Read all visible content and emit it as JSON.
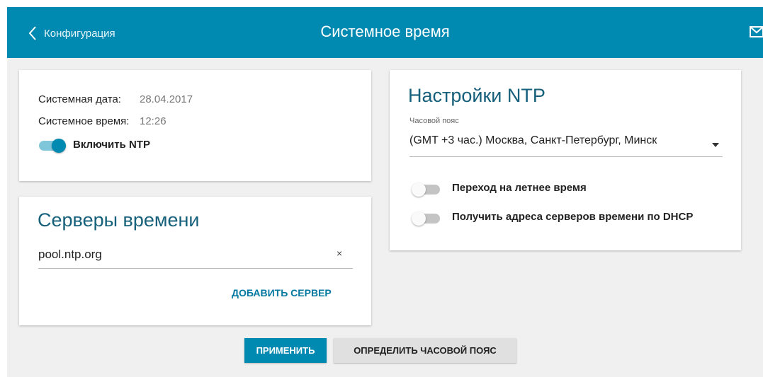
{
  "header": {
    "back_label": "Конфигурация",
    "title": "Системное время",
    "back_icon": "chevron-left-icon",
    "mail_icon": "mail-icon"
  },
  "colors": {
    "accent": "#0089b1",
    "title_text": "#16607b",
    "background": "#f0f0f0"
  },
  "system_info": {
    "date_label": "Системная дата:",
    "date_value": "28.04.2017",
    "time_label": "Системное время:",
    "time_value": "12:26",
    "ntp_toggle_label": "Включить NTP",
    "ntp_enabled": true
  },
  "time_servers": {
    "title": "Серверы времени",
    "servers": [
      "pool.ntp.org"
    ],
    "clear_glyph": "×",
    "add_label": "ДОБАВИТЬ СЕРВЕР"
  },
  "ntp_settings": {
    "title": "Настройки NTP",
    "timezone_label": "Часовой пояс",
    "timezone_value": "(GMT +3 час.) Москва, Санкт-Петербург, Минск",
    "dst_label": "Переход на летнее время",
    "dst_enabled": false,
    "dhcp_label": "Получить адреса серверов времени по DHCP",
    "dhcp_enabled": false
  },
  "actions": {
    "apply_label": "ПРИМЕНИТЬ",
    "detect_tz_label": "ОПРЕДЕЛИТЬ ЧАСОВОЙ ПОЯС"
  }
}
